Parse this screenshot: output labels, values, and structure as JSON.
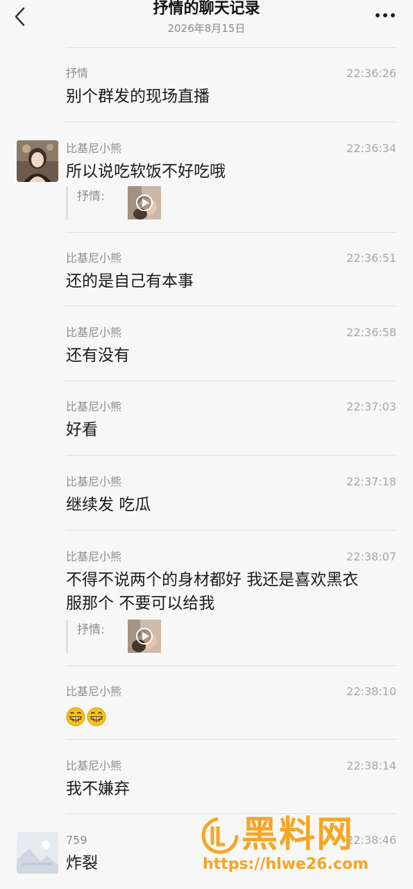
{
  "header": {
    "title": "抒情的聊天记录",
    "date": "2026年8月15日",
    "back_icon": "chevron-left-icon",
    "more_icon": "more-dots-icon"
  },
  "messages": [
    {
      "sender": "抒情",
      "time": "22:36:26",
      "text": "别个群发的现场直播"
    },
    {
      "sender": "比基尼小熊",
      "time": "22:36:34",
      "text": "所以说吃软饭不好吃哦",
      "quote_label": "抒情:"
    },
    {
      "sender": "比基尼小熊",
      "time": "22:36:51",
      "text": "还的是自己有本事"
    },
    {
      "sender": "比基尼小熊",
      "time": "22:36:58",
      "text": "还有没有"
    },
    {
      "sender": "比基尼小熊",
      "time": "22:37:03",
      "text": "好看"
    },
    {
      "sender": "比基尼小熊",
      "time": "22:37:18",
      "text": "继续发 吃瓜"
    },
    {
      "sender": "比基尼小熊",
      "time": "22:38:07",
      "text_line1": "不得不说两个的身材都好 我还是喜欢黑衣",
      "text_line2": "服那个 不要可以给我",
      "quote_label": "抒情:"
    },
    {
      "sender": "比基尼小熊",
      "time": "22:38:10",
      "emoji_icon": "grinning-face-icon"
    },
    {
      "sender": "比基尼小熊",
      "time": "22:38:14",
      "text": "我不嫌弃"
    },
    {
      "sender": "759",
      "time": "22:38:46",
      "text": "炸裂"
    }
  ],
  "watermark": {
    "text": "黑料网",
    "url": "https://hlwe26.com",
    "color": "#f5a623"
  }
}
